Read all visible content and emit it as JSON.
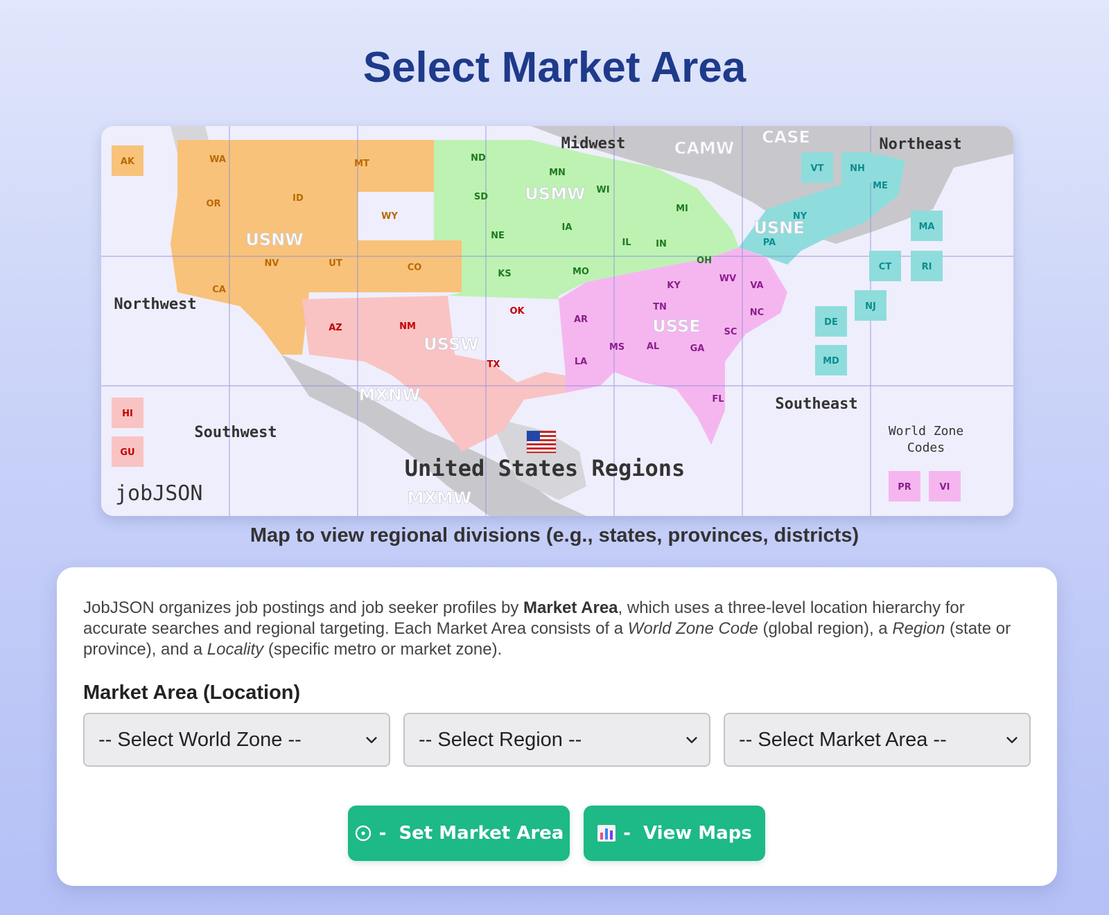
{
  "header": {
    "title": "Select Market Area"
  },
  "map": {
    "caption": "Map to view regional divisions (e.g., states, provinces, districts)",
    "main_title": "United States Regions",
    "brand": "jobJSON",
    "region_labels": {
      "northwest": "Northwest",
      "southwest": "Southwest",
      "midwest": "Midwest",
      "northeast": "Northeast",
      "southeast": "Southeast",
      "world_zone_codes_line1": "World Zone",
      "world_zone_codes_line2": "Codes"
    },
    "zone_codes": {
      "usnw": "USNW",
      "ussw": "USSW",
      "usmw": "USMW",
      "usne": "USNE",
      "usse": "USSE",
      "camw": "CAMW",
      "case": "CASE",
      "mxnw": "MXNW",
      "mxmw": "MXMW"
    },
    "states": {
      "ak": "AK",
      "wa": "WA",
      "or": "OR",
      "ca": "CA",
      "id": "ID",
      "nv": "NV",
      "mt": "MT",
      "wy": "WY",
      "ut": "UT",
      "co": "CO",
      "az": "AZ",
      "nm": "NM",
      "tx": "TX",
      "ok": "OK",
      "nd": "ND",
      "sd": "SD",
      "ne": "NE",
      "ks": "KS",
      "mn": "MN",
      "ia": "IA",
      "mo": "MO",
      "wi": "WI",
      "il": "IL",
      "in": "IN",
      "mi": "MI",
      "oh": "OH",
      "ar": "AR",
      "la": "LA",
      "ms": "MS",
      "al": "AL",
      "tn": "TN",
      "ky": "KY",
      "ga": "GA",
      "fl": "FL",
      "sc": "SC",
      "nc": "NC",
      "va": "VA",
      "wv": "WV",
      "pa": "PA",
      "ny": "NY",
      "vt": "VT",
      "nh": "NH",
      "me": "ME",
      "ma": "MA",
      "ct": "CT",
      "ri": "RI",
      "nj": "NJ",
      "de": "DE",
      "md": "MD",
      "hi": "HI",
      "gu": "GU",
      "pr": "PR",
      "vi": "VI"
    },
    "colors": {
      "west": "#f8c27a",
      "southwest": "#f9c3c3",
      "midwest": "#bdf2b3",
      "southeast": "#f5b6f0",
      "northeast": "#8fdcdc",
      "land": "#c8c8cc",
      "water": "#efeefc"
    }
  },
  "form": {
    "intro": {
      "p1": "JobJSON organizes job postings and job seeker profiles by ",
      "b1": "Market Area",
      "p2": ", which uses a three-level location hierarchy for accurate searches and regional targeting. Each Market Area consists of a ",
      "i1": "World Zone Code",
      "p3": " (global region), a ",
      "i2": "Region",
      "p4": " (state or province), and a ",
      "i3": "Locality",
      "p5": " (specific metro or market zone)."
    },
    "field_label": "Market Area (Location)",
    "world_zone_select": "-- Select World Zone --",
    "region_select": "-- Select Region --",
    "market_area_select": "-- Select Market Area --",
    "set_button": {
      "dash": "-",
      "label": "Set Market Area"
    },
    "view_button": {
      "dash": "-",
      "label": "View Maps"
    }
  }
}
